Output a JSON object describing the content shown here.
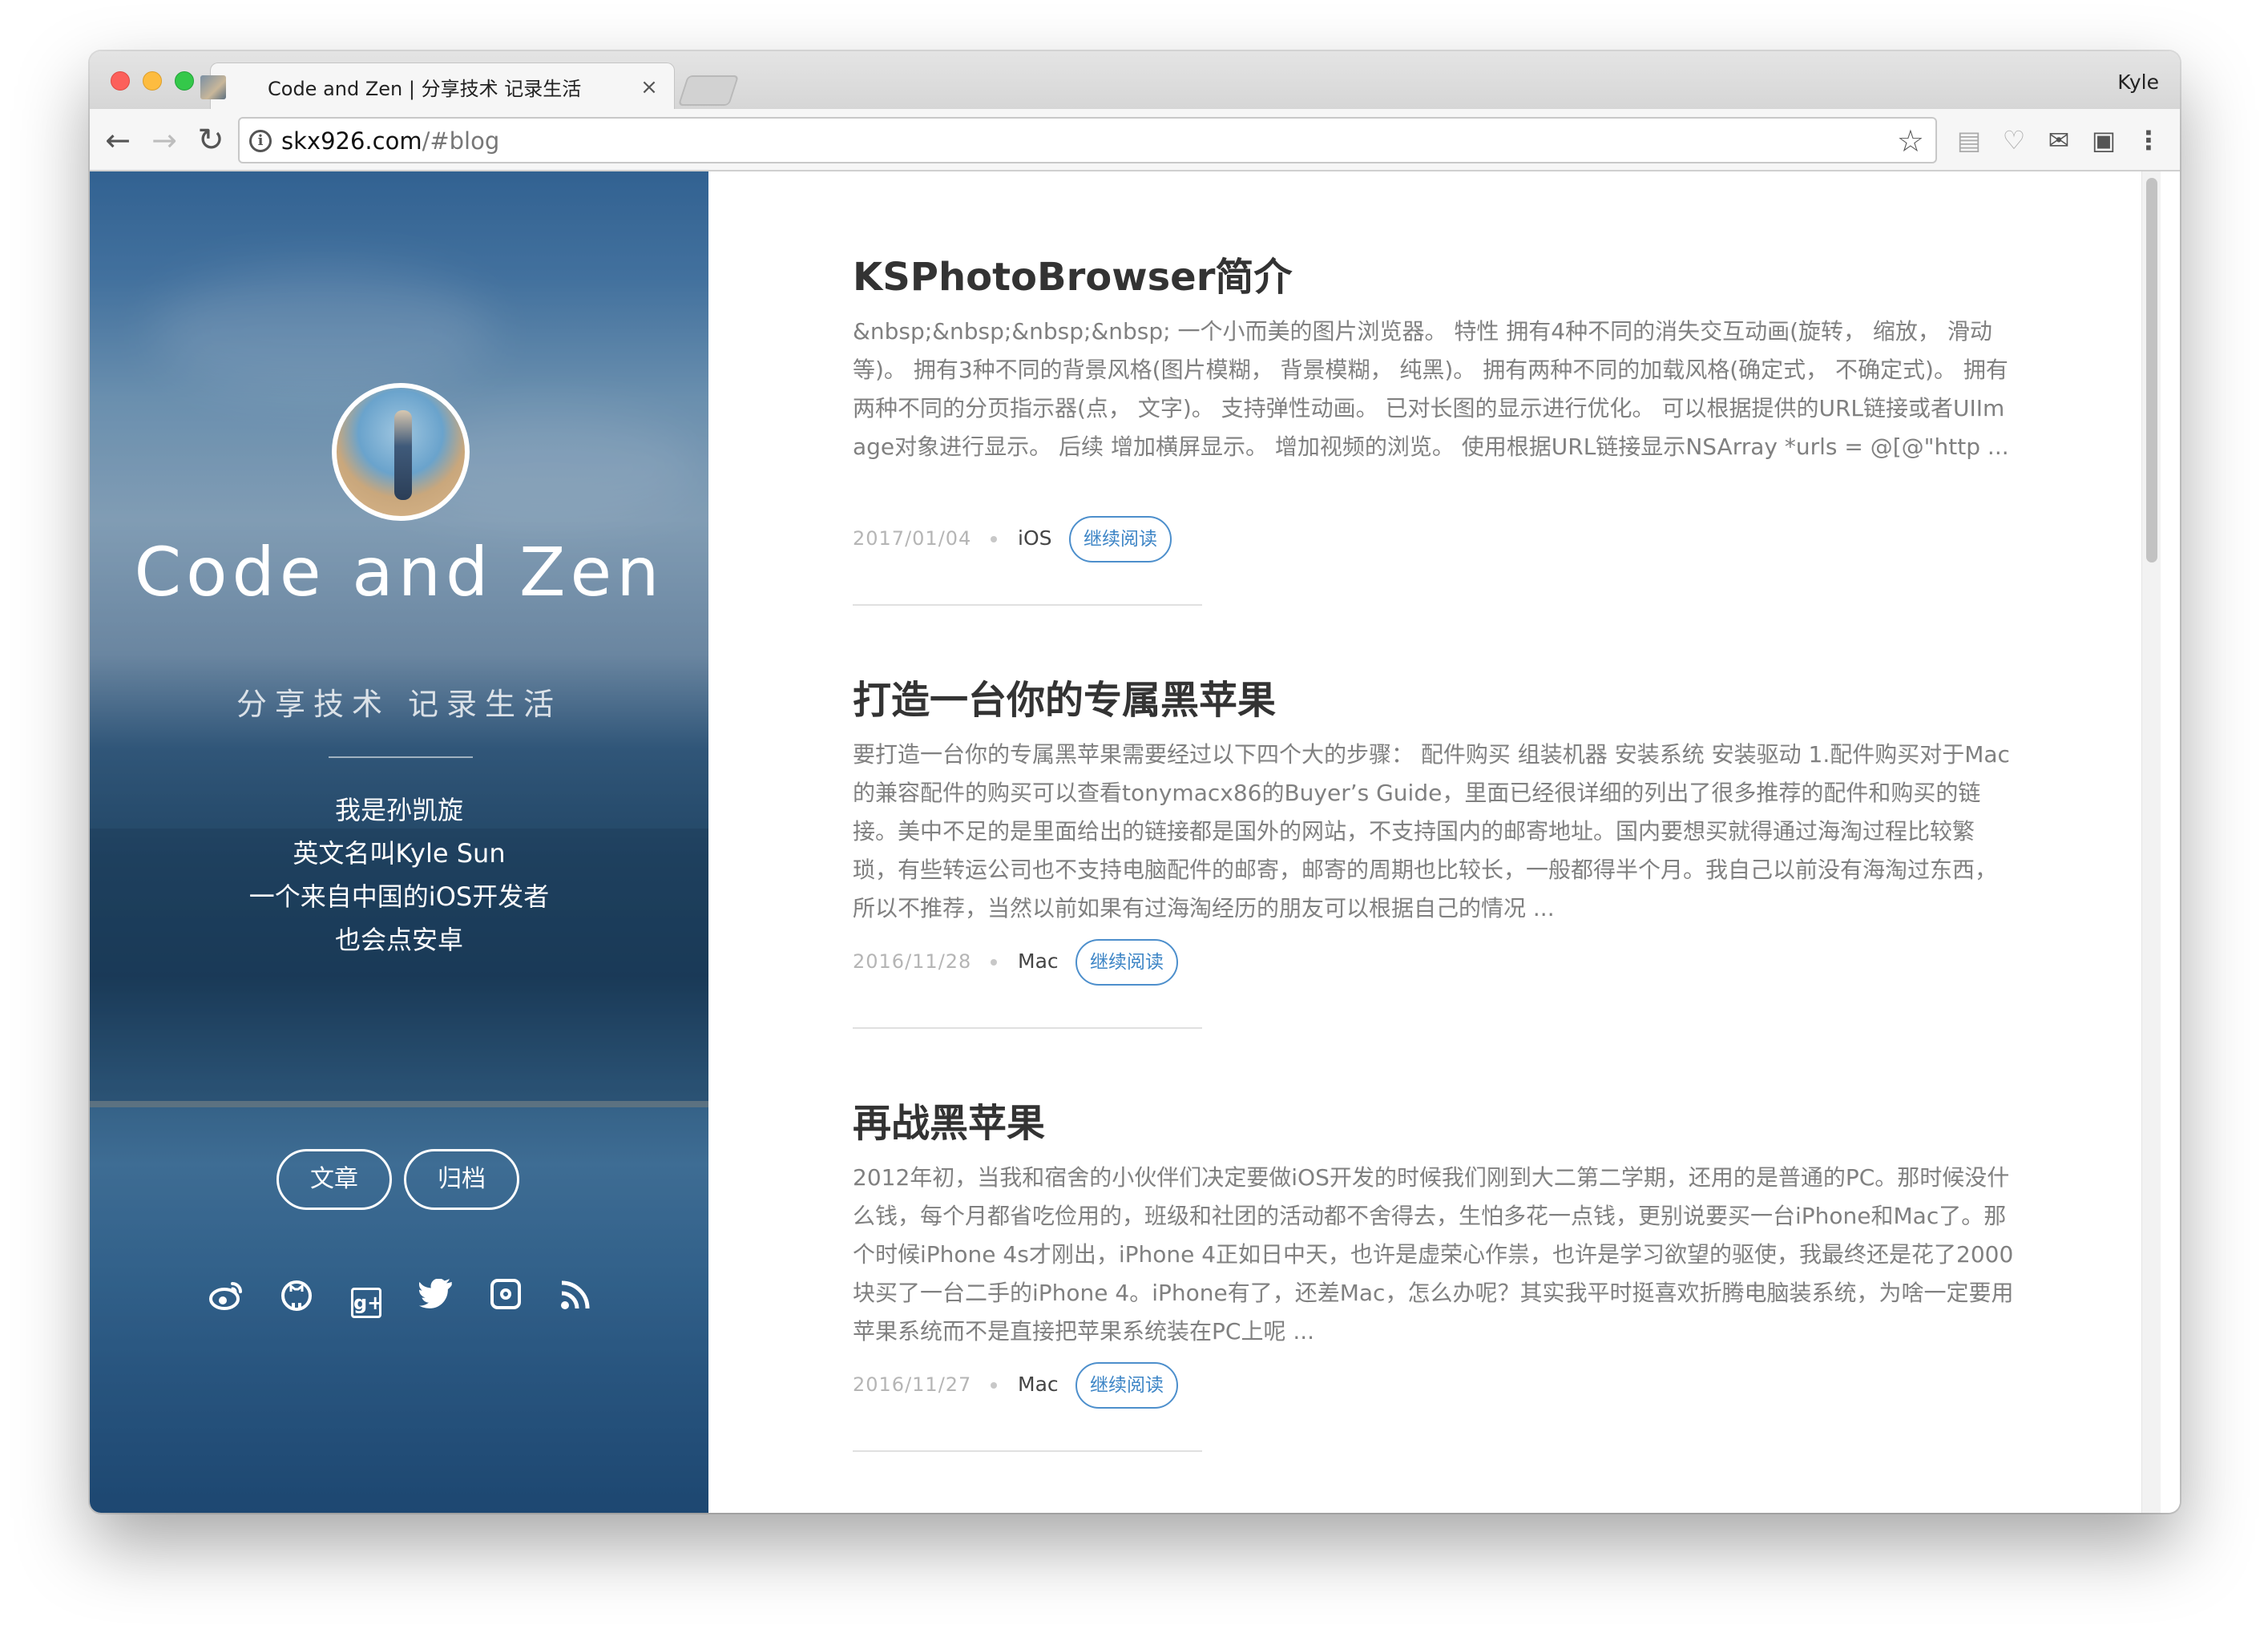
{
  "browser": {
    "tab_title": "Code and Zen | 分享技术 记录生活",
    "tab_close": "×",
    "profile_name": "Kyle",
    "url_host": "skx926.com",
    "url_path": "/#blog",
    "icons": {
      "back": "arrow-left-icon",
      "forward": "arrow-right-icon",
      "reload": "reload-icon",
      "info": "info-icon",
      "bookmark": "star-icon",
      "menu": "kebab-menu-icon"
    }
  },
  "sidebar": {
    "title": "Code and Zen",
    "subtitle": "分享技术 记录生活",
    "bio": [
      "我是孙凯旋",
      "英文名叫Kyle Sun",
      "一个来自中国的iOS开发者",
      "也会点安卓"
    ],
    "nav": {
      "articles_label": "文章",
      "archive_label": "归档"
    },
    "social": [
      "weibo-icon",
      "github-icon",
      "google-plus-icon",
      "twitter-icon",
      "instagram-icon",
      "rss-icon"
    ]
  },
  "posts": [
    {
      "title": "KSPhotoBrowser简介",
      "excerpt": "&nbsp;&nbsp;&nbsp;&nbsp; 一个小而美的图片浏览器。 特性 拥有4种不同的消失交互动画(旋转， 缩放， 滑动等)。 拥有3种不同的背景风格(图片模糊， 背景模糊， 纯黑)。 拥有两种不同的加载风格(确定式， 不确定式)。 拥有两种不同的分页指示器(点， 文字)。 支持弹性动画。 已对长图的显示进行优化。 可以根据提供的URL链接或者UIImage对象进行显示。 后续 增加横屏显示。 增加视频的浏览。 使用根据URL链接显示NSArray *urls = @[@\"http ...",
      "date": "2017/01/04",
      "category": "iOS",
      "read_more": "继续阅读"
    },
    {
      "title": "打造一台你的专属黑苹果",
      "excerpt": "要打造一台你的专属黑苹果需要经过以下四个大的步骤： 配件购买 组装机器 安装系统 安装驱动 1.配件购买对于Mac的兼容配件的购买可以查看tonymacx86的Buyer’s Guide，里面已经很详细的列出了很多推荐的配件和购买的链接。美中不足的是里面给出的链接都是国外的网站，不支持国内的邮寄地址。国内要想买就得通过海淘过程比较繁琐，有些转运公司也不支持电脑配件的邮寄，邮寄的周期也比较长，一般都得半个月。我自己以前没有海淘过东西，所以不推荐，当然以前如果有过海淘经历的朋友可以根据自己的情况 ...",
      "date": "2016/11/28",
      "category": "Mac",
      "read_more": "继续阅读"
    },
    {
      "title": "再战黑苹果",
      "excerpt": "2012年初，当我和宿舍的小伙伴们决定要做iOS开发的时候我们刚到大二第二学期，还用的是普通的PC。那时候没什么钱，每个月都省吃俭用的，班级和社团的活动都不舍得去，生怕多花一点钱，更别说要买一台iPhone和Mac了。那个时候iPhone 4s才刚出，iPhone 4正如日中天，也许是虚荣心作祟，也许是学习欲望的驱使，我最终还是花了2000块买了一台二手的iPhone 4。iPhone有了，还差Mac，怎么办呢？其实我平时挺喜欢折腾电脑装系统，为啥一定要用苹果系统而不是直接把苹果系统装在PC上呢 ...",
      "date": "2016/11/27",
      "category": "Mac",
      "read_more": "继续阅读"
    }
  ]
}
